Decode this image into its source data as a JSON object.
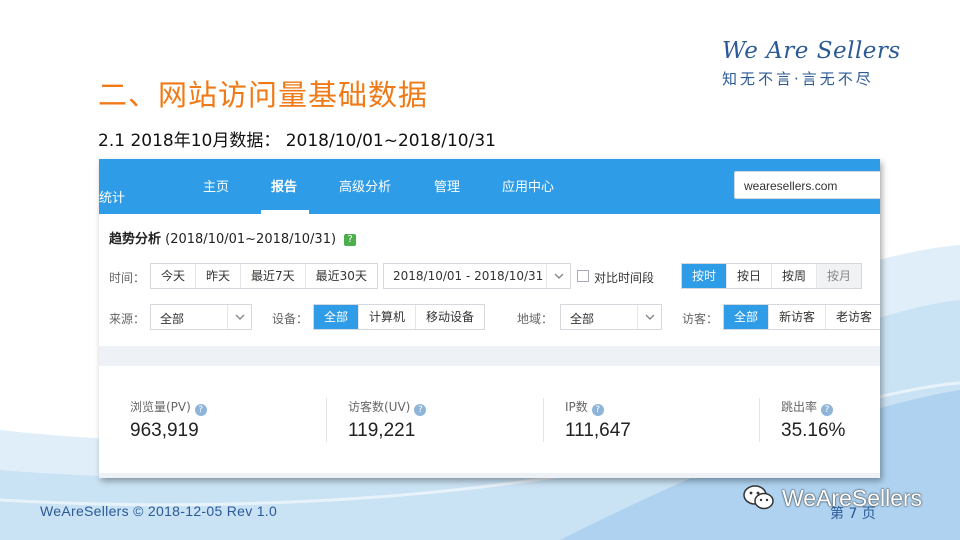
{
  "slide": {
    "title": "二、网站访问量基础数据",
    "subtitle": "2.1  2018年10月数据： 2018/10/01~2018/10/31",
    "brand_name": "We Are Sellers",
    "brand_tagline": "知无不言·言无不尽",
    "footer": "WeAreSellers © 2018-12-05  Rev 1.0",
    "page_label": "第 7 页",
    "watermark": "WeAreSellers"
  },
  "nav": {
    "brand_partial": "统计",
    "items": [
      "主页",
      "报告",
      "高级分析",
      "管理",
      "应用中心"
    ],
    "active": "报告",
    "site_value": "wearesellers.com"
  },
  "trend": {
    "title": "趋势分析",
    "range": "(2018/10/01~2018/10/31)",
    "help": "?"
  },
  "time_row": {
    "label": "时间：",
    "quick": [
      "今天",
      "昨天",
      "最近7天",
      "最近30天"
    ],
    "date_range": "2018/10/01 - 2018/10/31",
    "compare_label": "对比时间段",
    "granularity": [
      {
        "label": "按时",
        "state": "selected"
      },
      {
        "label": "按日",
        "state": "normal"
      },
      {
        "label": "按周",
        "state": "normal"
      },
      {
        "label": "按月",
        "state": "disabled"
      }
    ]
  },
  "filter_row": {
    "source_label": "来源：",
    "source_value": "全部",
    "device_label": "设备：",
    "device_options": [
      {
        "label": "全部",
        "state": "selected"
      },
      {
        "label": "计算机",
        "state": "normal"
      },
      {
        "label": "移动设备",
        "state": "normal"
      }
    ],
    "region_label": "地域：",
    "region_value": "全部",
    "visitor_label": "访客：",
    "visitor_options": [
      {
        "label": "全部",
        "state": "selected"
      },
      {
        "label": "新访客",
        "state": "normal"
      },
      {
        "label": "老访客",
        "state": "normal"
      }
    ]
  },
  "stats": [
    {
      "label": "浏览量(PV)",
      "value": "963,919"
    },
    {
      "label": "访客数(UV)",
      "value": "119,221"
    },
    {
      "label": "IP数",
      "value": "111,647"
    },
    {
      "label": "跳出率",
      "value": "35.16%"
    }
  ],
  "colors": {
    "accent_orange": "#f07a17",
    "brand_blue": "#2c5a97",
    "nav_blue": "#2e9ce6"
  }
}
